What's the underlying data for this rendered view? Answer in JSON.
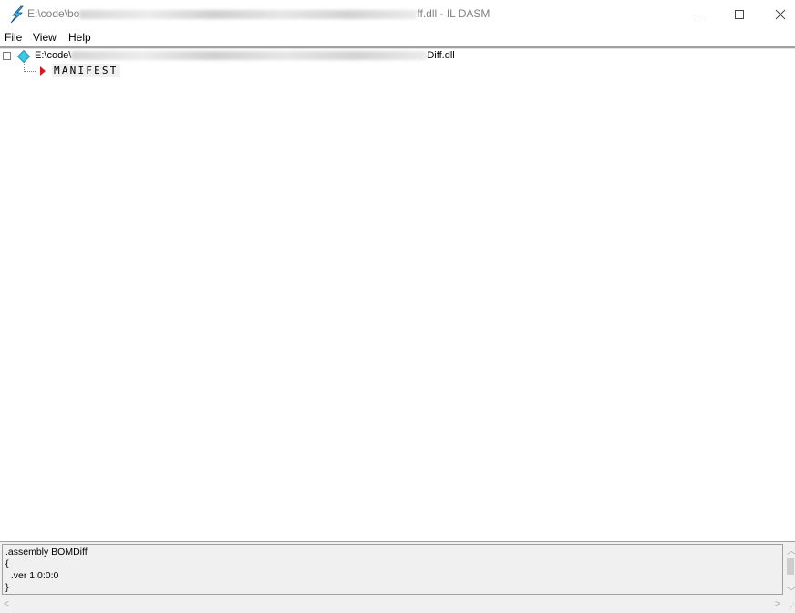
{
  "window": {
    "title_prefix": "E:\\code\\bo",
    "title_suffix": "ff.dll - IL DASM"
  },
  "menu": [
    {
      "label": "File"
    },
    {
      "label": "View"
    },
    {
      "label": "Help"
    }
  ],
  "tree": {
    "root_prefix": "E:\\code\\",
    "root_suffix": "Diff.dll",
    "child_label": "MANIFEST"
  },
  "output": {
    "text": ".assembly BOMDiff\n{\n  .ver 1:0:0:0\n}"
  },
  "colors": {
    "manifest_arrow": "#e0141e",
    "root_icon": "#3fc8e6",
    "menu_separator": "#a0a0a0"
  },
  "icons": {
    "app": "il-dasm-lightning-icon",
    "root": "diamond-assembly-icon",
    "manifest": "red-triangle-icon"
  }
}
